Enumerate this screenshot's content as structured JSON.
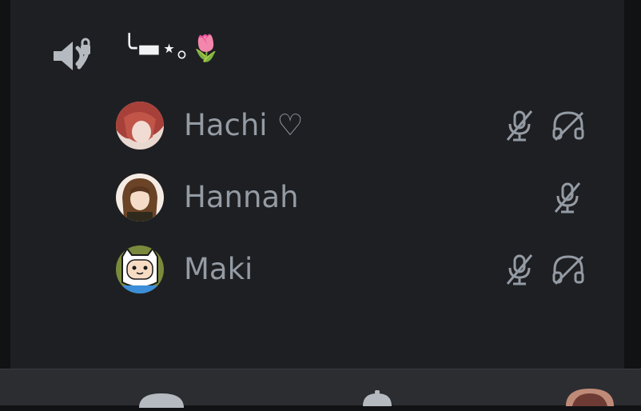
{
  "channel": {
    "name": "╰▬⋆｡🌷",
    "icon": "speaker-lock-icon"
  },
  "users": [
    {
      "name": "Hachi ♡",
      "muted": true,
      "deafened": true
    },
    {
      "name": "Hannah",
      "muted": true,
      "deafened": false
    },
    {
      "name": "Maki",
      "muted": true,
      "deafened": true
    }
  ],
  "bottom_nav": [
    {
      "icon": "home-icon"
    },
    {
      "icon": "notifications-icon"
    },
    {
      "icon": "profile-avatar"
    }
  ],
  "colors": {
    "panel": "#1e1f22",
    "background": "#111214",
    "muted_text": "#949ba4",
    "icon": "#b5bac1"
  }
}
